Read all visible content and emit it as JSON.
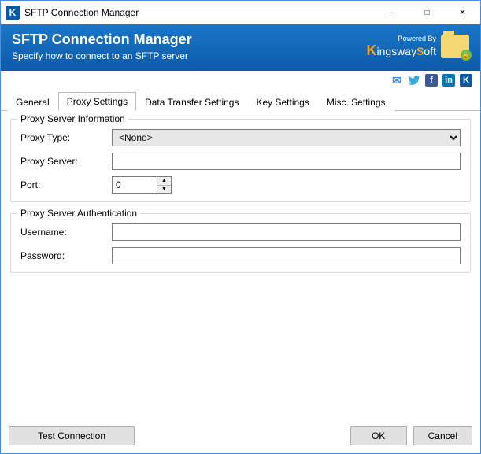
{
  "window": {
    "title": "SFTP Connection Manager"
  },
  "header": {
    "title": "SFTP Connection Manager",
    "subtitle": "Specify how to connect to an SFTP server",
    "powered_by": "Powered By",
    "brand_prefix": "K",
    "brand_mid": "ingsway",
    "brand_suffix": "S",
    "brand_end": "oft"
  },
  "tabs": {
    "general": "General",
    "proxy": "Proxy Settings",
    "datatransfer": "Data Transfer Settings",
    "keysettings": "Key Settings",
    "misc": "Misc. Settings"
  },
  "groups": {
    "info": {
      "legend": "Proxy Server Information",
      "proxy_type_label": "Proxy Type:",
      "proxy_type_value": "<None>",
      "proxy_server_label": "Proxy Server:",
      "proxy_server_value": "",
      "port_label": "Port:",
      "port_value": "0"
    },
    "auth": {
      "legend": "Proxy Server Authentication",
      "username_label": "Username:",
      "username_value": "",
      "password_label": "Password:",
      "password_value": ""
    }
  },
  "buttons": {
    "test": "Test Connection",
    "ok": "OK",
    "cancel": "Cancel"
  }
}
